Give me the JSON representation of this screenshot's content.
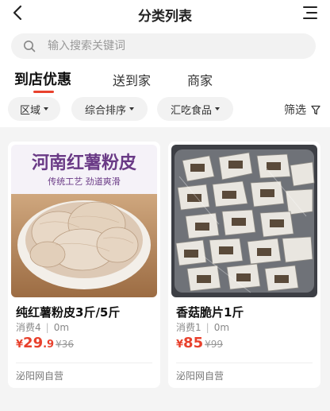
{
  "header": {
    "title": "分类列表",
    "back_icon": "chevron-left-icon",
    "menu_icon": "menu-icon"
  },
  "search": {
    "placeholder": "输入搜索关键词",
    "value": ""
  },
  "tabs": [
    {
      "label": "到店优惠",
      "active": true
    },
    {
      "label": "送到家",
      "active": false
    },
    {
      "label": "商家",
      "active": false
    }
  ],
  "filters": {
    "chips": [
      {
        "label": "区域"
      },
      {
        "label": "综合排序"
      },
      {
        "label": "汇吃食品"
      }
    ],
    "filter_label": "筛选"
  },
  "products": [
    {
      "name": "纯红薯粉皮3斤/5斤",
      "sold": "消费4",
      "distance": "0m",
      "price_symbol": "¥",
      "price_int": "29",
      "price_dec": ".9",
      "original_price": "¥36",
      "shop": "泌阳网自营",
      "image_title": "河南红薯粉皮",
      "image_subtitle": "传统工艺 劲道爽滑"
    },
    {
      "name": "香菇脆片1斤",
      "sold": "消费1",
      "distance": "0m",
      "price_symbol": "¥",
      "price_int": "85",
      "price_dec": "",
      "original_price": "¥99",
      "shop": "泌阳网自营"
    }
  ],
  "colors": {
    "accent": "#e8412d",
    "background": "#f4f4f4"
  }
}
